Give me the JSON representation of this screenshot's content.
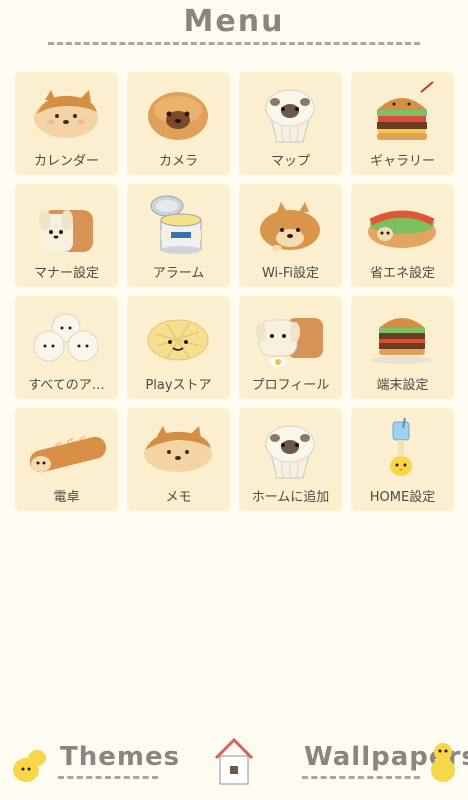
{
  "header": {
    "title": "Menu"
  },
  "tiles": [
    {
      "label": "カレンダー",
      "icon": "shiba-bread-icon"
    },
    {
      "label": "カメラ",
      "icon": "pug-bun-icon"
    },
    {
      "label": "マップ",
      "icon": "pug-muffin-icon"
    },
    {
      "label": "ギャラリー",
      "icon": "burger-icon"
    },
    {
      "label": "マナー設定",
      "icon": "bread-loaf-dog-icon"
    },
    {
      "label": "アラーム",
      "icon": "chick-tin-can-icon"
    },
    {
      "label": "Wi-Fi設定",
      "icon": "shiba-bun-icon"
    },
    {
      "label": "省エネ設定",
      "icon": "hotdog-icon"
    },
    {
      "label": "すべてのア…",
      "icon": "steamed-buns-icon"
    },
    {
      "label": "Playストア",
      "icon": "melon-pan-icon"
    },
    {
      "label": "プロフィール",
      "icon": "dog-toast-icon"
    },
    {
      "label": "端末設定",
      "icon": "stacked-burger-icon"
    },
    {
      "label": "電卓",
      "icon": "shiba-baguette-icon"
    },
    {
      "label": "メモ",
      "icon": "shiba-bread-icon"
    },
    {
      "label": "ホームに追加",
      "icon": "pug-muffin-icon"
    },
    {
      "label": "HOME設定",
      "icon": "chick-drink-icon"
    }
  ],
  "bottom": {
    "themes_label": "Themes",
    "wallpapers_label": "Wallpapers",
    "home_icon": "house-icon"
  },
  "colors": {
    "background": "#fefbf1",
    "tile": "#fcefcf",
    "text": "#4e4a45",
    "title": "#8a8580"
  }
}
